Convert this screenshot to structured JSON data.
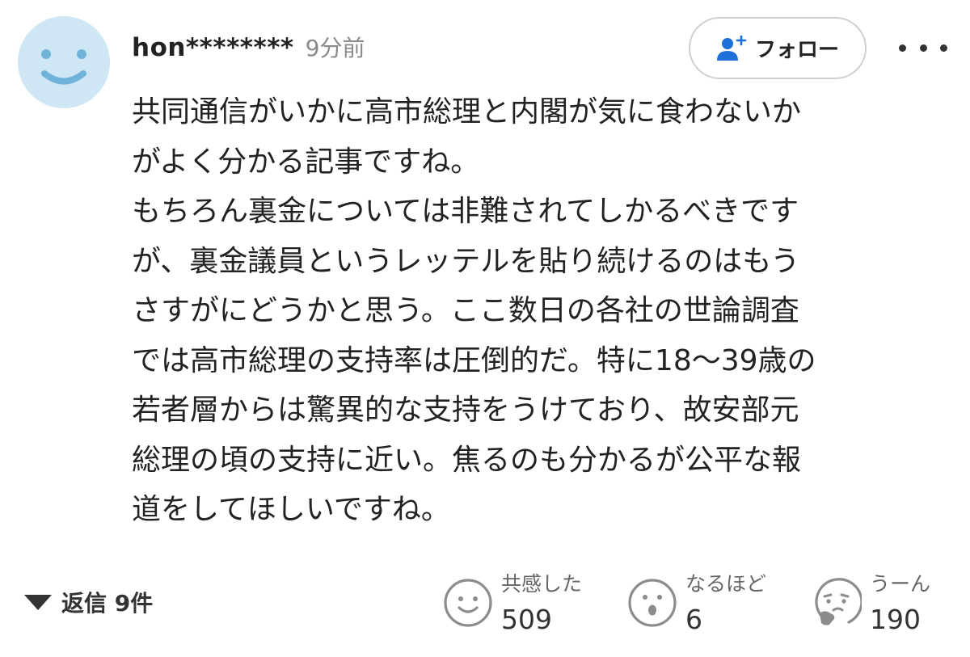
{
  "comment": {
    "username": "hon********",
    "time": "9分前",
    "follow_label": "フォロー",
    "body_lines": [
      "共同通信がいかに高市総理と内閣が気に食わないか",
      "がよく分かる記事ですね。",
      "もちろん裏金については非難されてしかるべきです",
      "が、裏金議員というレッテルを貼り続けるのはもう",
      "さすがにどうかと思う。ここ数日の各社の世論調査",
      "では高市総理の支持率は圧倒的だ。特に18〜39歳の",
      "若者層からは驚異的な支持をうけており、故安部元",
      "総理の頃の支持に近い。焦るのも分かるが公平な報",
      "道をしてほしいですね。"
    ],
    "replies_label": "返信 9件",
    "reactions": [
      {
        "icon": "smile-face-icon",
        "label": "共感した",
        "count": "509"
      },
      {
        "icon": "surprised-face-icon",
        "label": "なるほど",
        "count": "6"
      },
      {
        "icon": "thinking-face-icon",
        "label": "うーん",
        "count": "190"
      }
    ]
  },
  "colors": {
    "avatar_bg": "#cfe7f5",
    "avatar_face": "#6fb3db",
    "follow_icon": "#1e6fd9",
    "reaction_icon": "#8c8c8c",
    "text": "#222222",
    "muted": "#8a8a8a"
  }
}
